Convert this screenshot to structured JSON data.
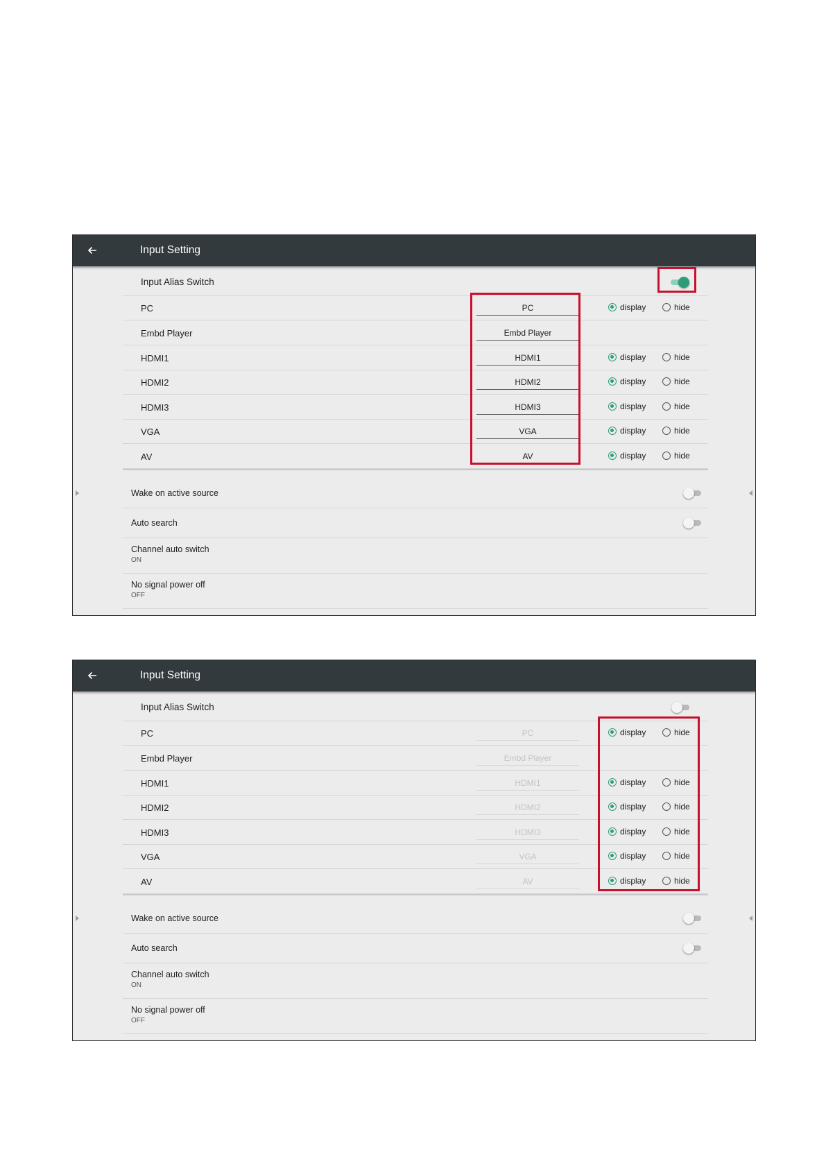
{
  "colors": {
    "accent": "#2a9d79",
    "titlebar": "#323a3d",
    "highlight": "#c8102e",
    "panel": "#ececec"
  },
  "screens": [
    {
      "back_icon": "arrow-left-icon",
      "title": "Input Setting",
      "alias_switch": {
        "label": "Input Alias Switch",
        "on": true
      },
      "sources": [
        {
          "name": "PC",
          "alias": "PC",
          "display_label": "display",
          "hide_label": "hide",
          "selected": "display"
        },
        {
          "name": "Embd Player",
          "alias": "Embd Player"
        },
        {
          "name": "HDMI1",
          "alias": "HDMI1",
          "display_label": "display",
          "hide_label": "hide",
          "selected": "display"
        },
        {
          "name": "HDMI2",
          "alias": "HDMI2",
          "display_label": "display",
          "hide_label": "hide",
          "selected": "display"
        },
        {
          "name": "HDMI3",
          "alias": "HDMI3",
          "display_label": "display",
          "hide_label": "hide",
          "selected": "display"
        },
        {
          "name": "VGA",
          "alias": "VGA",
          "display_label": "display",
          "hide_label": "hide",
          "selected": "display"
        },
        {
          "name": "AV",
          "alias": "AV",
          "display_label": "display",
          "hide_label": "hide",
          "selected": "display"
        }
      ],
      "settings": [
        {
          "label": "Wake on active source",
          "toggle": false
        },
        {
          "label": "Auto search",
          "toggle": false
        },
        {
          "label": "Channel auto switch",
          "value": "ON"
        },
        {
          "label": "No signal power off",
          "value": "OFF"
        }
      ]
    },
    {
      "back_icon": "arrow-left-icon",
      "title": "Input Setting",
      "alias_switch": {
        "label": "Input Alias Switch",
        "on": false
      },
      "sources": [
        {
          "name": "PC",
          "alias": "PC",
          "display_label": "display",
          "hide_label": "hide",
          "selected": "display"
        },
        {
          "name": "Embd Player",
          "alias": "Embd Player"
        },
        {
          "name": "HDMI1",
          "alias": "HDMI1",
          "display_label": "display",
          "hide_label": "hide",
          "selected": "display"
        },
        {
          "name": "HDMI2",
          "alias": "HDMI2",
          "display_label": "display",
          "hide_label": "hide",
          "selected": "display"
        },
        {
          "name": "HDMI3",
          "alias": "HDMI3",
          "display_label": "display",
          "hide_label": "hide",
          "selected": "display"
        },
        {
          "name": "VGA",
          "alias": "VGA",
          "display_label": "display",
          "hide_label": "hide",
          "selected": "display"
        },
        {
          "name": "AV",
          "alias": "AV",
          "display_label": "display",
          "hide_label": "hide",
          "selected": "display"
        }
      ],
      "settings": [
        {
          "label": "Wake on active source",
          "toggle": false
        },
        {
          "label": "Auto search",
          "toggle": false
        },
        {
          "label": "Channel auto switch",
          "value": "ON"
        },
        {
          "label": "No signal power off",
          "value": "OFF"
        }
      ]
    }
  ]
}
